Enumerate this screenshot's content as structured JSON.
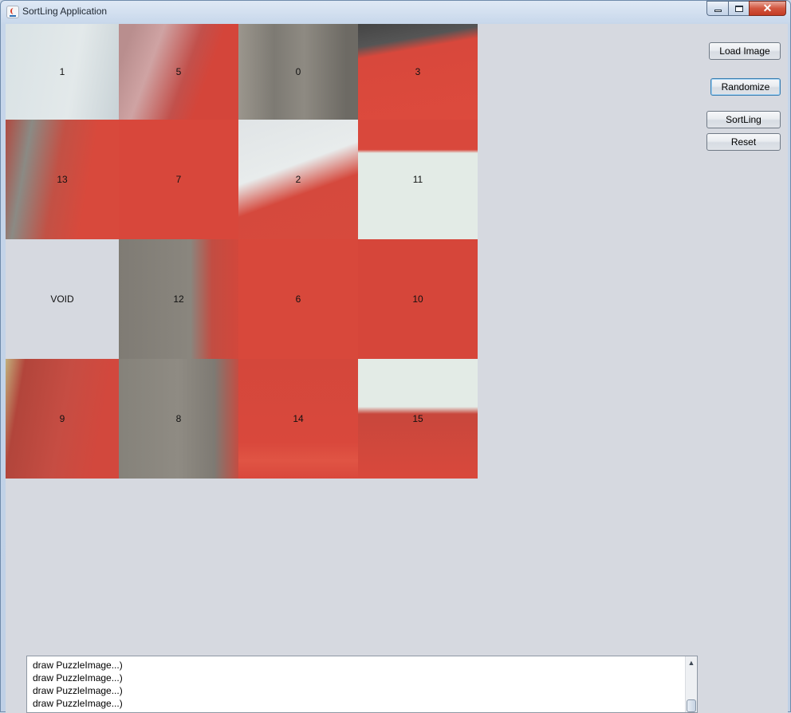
{
  "window": {
    "title": "SortLing Application",
    "close_glyph": "✕"
  },
  "buttons": {
    "load_image": "Load Image",
    "randomize": "Randomize",
    "sortling": "SortLing",
    "reset": "Reset"
  },
  "puzzle": {
    "grid": "4x4",
    "tiles": [
      {
        "label": "1",
        "name": "tile-1"
      },
      {
        "label": "5",
        "name": "tile-5"
      },
      {
        "label": "0",
        "name": "tile-0"
      },
      {
        "label": "3",
        "name": "tile-3"
      },
      {
        "label": "13",
        "name": "tile-13"
      },
      {
        "label": "7",
        "name": "tile-7"
      },
      {
        "label": "2",
        "name": "tile-2"
      },
      {
        "label": "11",
        "name": "tile-11"
      },
      {
        "label": "VOID",
        "name": "tile-void"
      },
      {
        "label": "12",
        "name": "tile-12"
      },
      {
        "label": "6",
        "name": "tile-6"
      },
      {
        "label": "10",
        "name": "tile-10"
      },
      {
        "label": "9",
        "name": "tile-9"
      },
      {
        "label": "8",
        "name": "tile-8"
      },
      {
        "label": "14",
        "name": "tile-14"
      },
      {
        "label": "15",
        "name": "tile-15"
      }
    ]
  },
  "log": {
    "lines": [
      "draw PuzzleImage...)",
      "draw PuzzleImage...)",
      "draw PuzzleImage...)",
      "draw PuzzleImage...)"
    ],
    "scroll_up_glyph": "▲"
  },
  "colors": {
    "window_bg": "#d6d9e0",
    "photo_red": "#d6493c",
    "photo_gray": "#8a8680",
    "photo_white": "#dfe6e6"
  },
  "icons": [
    "java-app-icon",
    "minimize-icon",
    "maximize-icon",
    "close-icon",
    "scroll-up-arrow-icon"
  ]
}
